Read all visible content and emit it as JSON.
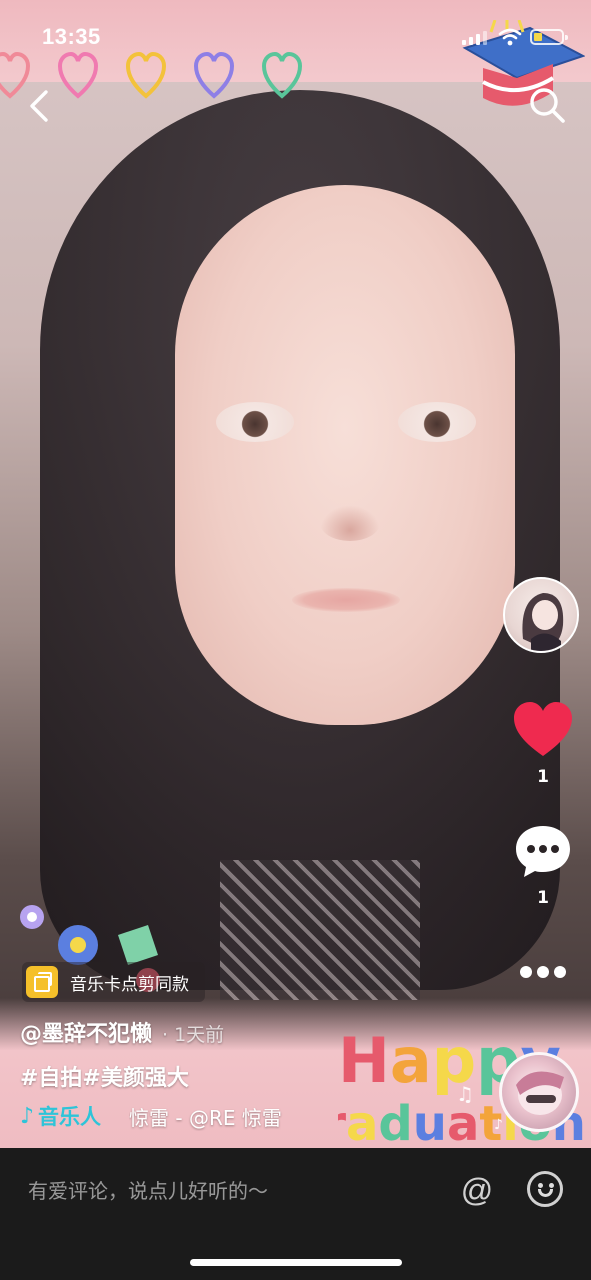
{
  "status_bar": {
    "time": "13:35",
    "battery_color": "#f5d84a"
  },
  "nav": {
    "back_icon": "chevron-left-icon",
    "search_icon": "search-icon"
  },
  "video": {
    "overlay_text_top": "Happy",
    "overlay_text_bottom": "graduation",
    "heart_colors": [
      "#f08a98",
      "#f07ab0",
      "#f3c23b",
      "#8e7fe6",
      "#59c59a"
    ]
  },
  "right_rail": {
    "like_count": "1",
    "comment_count": "1",
    "like_color": "#ef2a4f"
  },
  "post": {
    "template_label": "音乐卡点剪同款",
    "author": "@墨辞不犯懒",
    "posted_time": "· 1天前",
    "caption": "#自拍#美颜强大",
    "music_tag": "音乐人",
    "music_song": "惊雷 - @RE    惊雷",
    "accent_color": "#2ec4d8"
  },
  "comment_bar": {
    "placeholder": "有爱评论，说点儿好听的～",
    "at_label": "@"
  }
}
